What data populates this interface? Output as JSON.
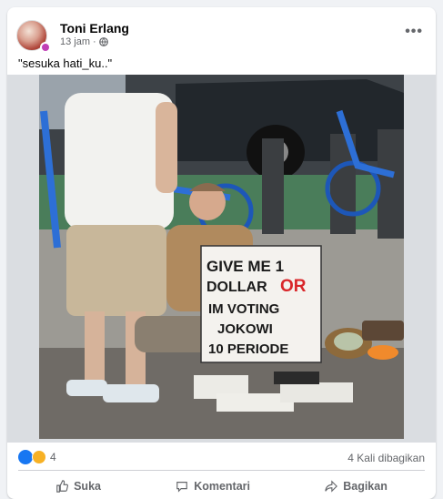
{
  "post": {
    "author": "Toni Erlang",
    "time": "13 jam",
    "separator": "·",
    "caption": "\"sesuka hati_ku..\"",
    "more_label": "•••"
  },
  "image": {
    "sign_lines": [
      "GIVE ME 1",
      "DOLLAR",
      "OR",
      "IM VOTING",
      "JOKOWI",
      "10 PERIODE"
    ]
  },
  "stats": {
    "reaction_count": "4",
    "shares": "4 Kali dibagikan"
  },
  "actions": {
    "like": "Suka",
    "comment": "Komentari",
    "share": "Bagikan"
  },
  "colors": {
    "brand": "#1877f2",
    "sign_accent": "#d9262a"
  }
}
